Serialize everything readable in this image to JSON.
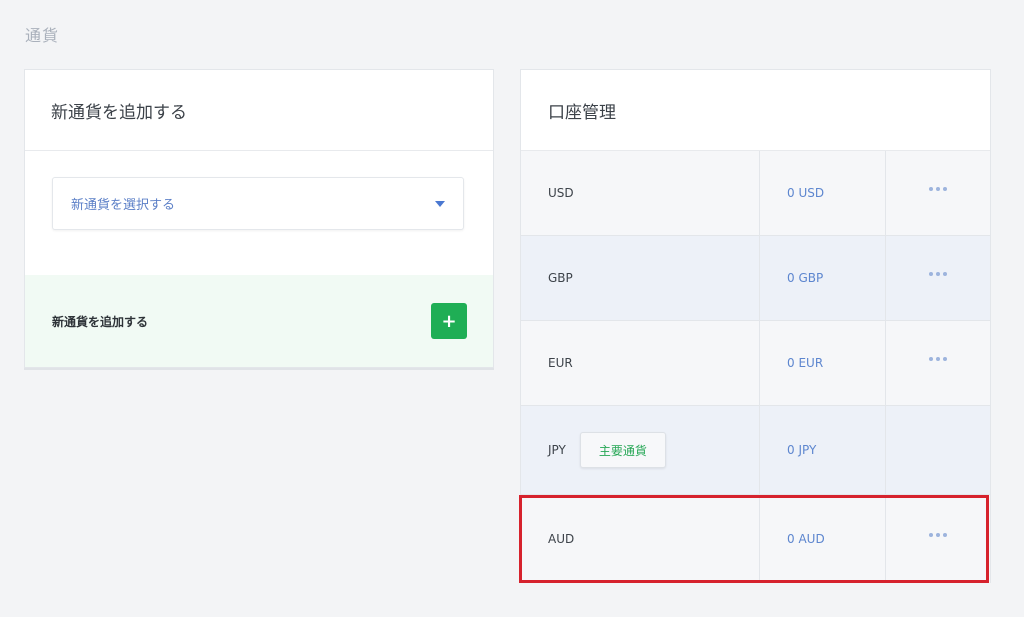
{
  "page": {
    "title": "通貨"
  },
  "add_panel": {
    "title": "新通貨を追加する",
    "select_placeholder": "新通貨を選択する",
    "add_label": "新通貨を追加する",
    "add_button_symbol": "+"
  },
  "accounts_panel": {
    "title": "口座管理",
    "rows": [
      {
        "currency": "USD",
        "balance": "0 USD",
        "has_menu": true
      },
      {
        "currency": "GBP",
        "balance": "0 GBP",
        "has_menu": true
      },
      {
        "currency": "EUR",
        "balance": "0 EUR",
        "has_menu": true
      },
      {
        "currency": "JPY",
        "balance": "0 JPY",
        "badge": "主要通貨",
        "has_menu": false
      },
      {
        "currency": "AUD",
        "balance": "0 AUD",
        "has_menu": true,
        "highlighted": true
      }
    ]
  },
  "colors": {
    "accent_green": "#1fae55",
    "link_blue": "#5d86cf",
    "highlight_red": "#d6222d"
  }
}
